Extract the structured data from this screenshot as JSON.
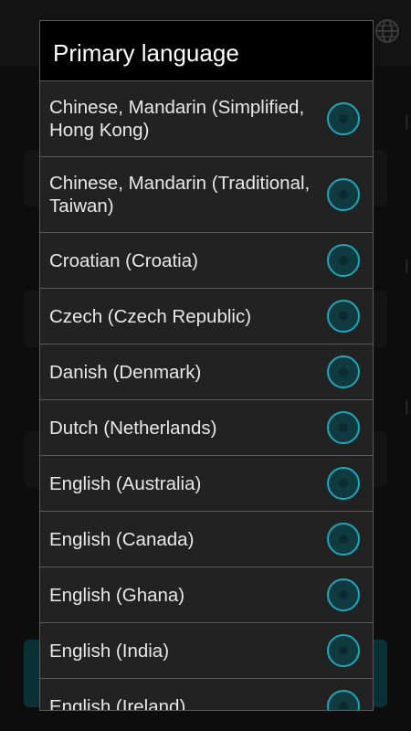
{
  "dialog": {
    "title": "Primary language",
    "options": [
      {
        "label": "Chinese, Mandarin (Simplified, Hong Kong)"
      },
      {
        "label": "Chinese, Mandarin (Traditional, Taiwan)"
      },
      {
        "label": "Croatian (Croatia)"
      },
      {
        "label": "Czech (Czech Republic)"
      },
      {
        "label": "Danish (Denmark)"
      },
      {
        "label": "Dutch (Netherlands)"
      },
      {
        "label": "English (Australia)"
      },
      {
        "label": "English (Canada)"
      },
      {
        "label": "English (Ghana)"
      },
      {
        "label": "English (India)"
      },
      {
        "label": "English (Ireland)"
      }
    ]
  },
  "colors": {
    "accent": "#1aa9b8",
    "dialog_background": "#222222",
    "title_background": "#000000"
  },
  "icons": {
    "header": "globe-icon",
    "option": "radio-button-icon"
  }
}
